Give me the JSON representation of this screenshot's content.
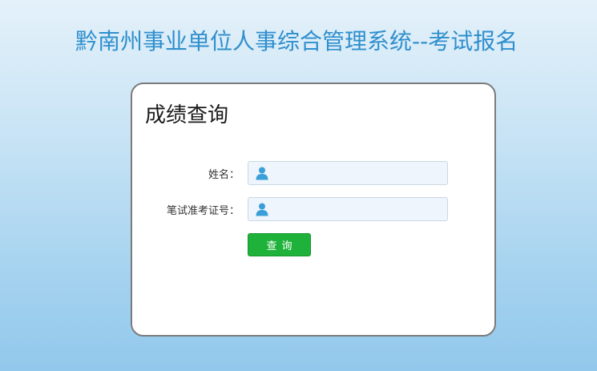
{
  "header": {
    "title": "黔南州事业单位人事综合管理系统--考试报名"
  },
  "panel": {
    "heading": "成绩查询",
    "fields": [
      {
        "label": "姓名：",
        "value": "",
        "placeholder": "",
        "icon": "user-icon"
      },
      {
        "label": "笔试准考证号：",
        "value": "",
        "placeholder": "",
        "icon": "user-icon"
      }
    ],
    "submit_label": "查询"
  },
  "colors": {
    "title": "#2f8fcd",
    "button": "#1fb23a",
    "icon": "#3a9fd8",
    "input_bg": "#eef5fc"
  }
}
